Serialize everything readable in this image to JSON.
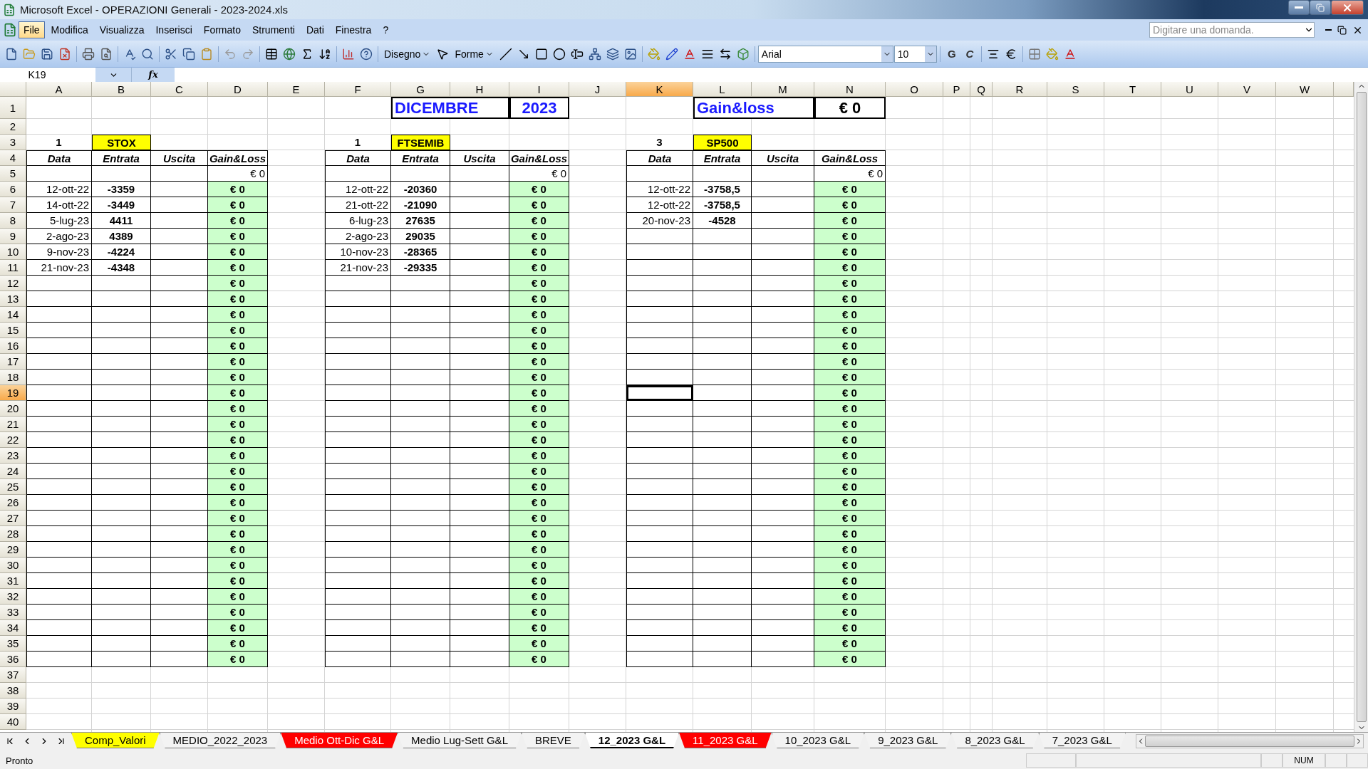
{
  "window": {
    "title": "Microsoft Excel - OPERAZIONI Generali - 2023-2024.xls"
  },
  "menu": [
    {
      "label": "File",
      "selected": true
    },
    {
      "label": "Modifica",
      "selected": false
    },
    {
      "label": "Visualizza",
      "selected": false
    },
    {
      "label": "Inserisci",
      "selected": false
    },
    {
      "label": "Formato",
      "selected": false
    },
    {
      "label": "Strumenti",
      "selected": false
    },
    {
      "label": "Dati",
      "selected": false
    },
    {
      "label": "Finestra",
      "selected": false
    },
    {
      "label": "?",
      "selected": false
    }
  ],
  "help_search": {
    "placeholder": "Digitare una domanda."
  },
  "drawing_toolbar": {
    "draw_menu": "Disegno",
    "shapes_menu": "Forme"
  },
  "formatting_toolbar": {
    "font": "Arial",
    "size": "10",
    "bold": "G",
    "italic": "C"
  },
  "formula_bar": {
    "name_box": "K19",
    "function_label": "fx"
  },
  "columns": [
    {
      "label": "A",
      "selected": false
    },
    {
      "label": "B",
      "selected": false
    },
    {
      "label": "C",
      "selected": false
    },
    {
      "label": "D",
      "selected": false
    },
    {
      "label": "E",
      "selected": false
    },
    {
      "label": "F",
      "selected": false
    },
    {
      "label": "G",
      "selected": false
    },
    {
      "label": "H",
      "selected": false
    },
    {
      "label": "I",
      "selected": false
    },
    {
      "label": "J",
      "selected": false
    },
    {
      "label": "K",
      "selected": true
    },
    {
      "label": "L",
      "selected": false
    },
    {
      "label": "M",
      "selected": false
    },
    {
      "label": "N",
      "selected": false
    },
    {
      "label": "O",
      "selected": false
    },
    {
      "label": "P",
      "selected": false
    },
    {
      "label": "Q",
      "selected": false
    },
    {
      "label": "R",
      "selected": false
    },
    {
      "label": "S",
      "selected": false
    },
    {
      "label": "T",
      "selected": false
    },
    {
      "label": "U",
      "selected": false
    },
    {
      "label": "V",
      "selected": false
    },
    {
      "label": "W",
      "selected": false
    }
  ],
  "rows": [
    {
      "label": "1",
      "selected": false
    },
    {
      "label": "2",
      "selected": false
    },
    {
      "label": "3",
      "selected": false
    },
    {
      "label": "4",
      "selected": false
    },
    {
      "label": "5",
      "selected": false
    },
    {
      "label": "6",
      "selected": false
    },
    {
      "label": "7",
      "selected": false
    },
    {
      "label": "8",
      "selected": false
    },
    {
      "label": "9",
      "selected": false
    },
    {
      "label": "10",
      "selected": false
    },
    {
      "label": "11",
      "selected": false
    },
    {
      "label": "12",
      "selected": false
    },
    {
      "label": "13",
      "selected": false
    },
    {
      "label": "14",
      "selected": false
    },
    {
      "label": "15",
      "selected": false
    },
    {
      "label": "16",
      "selected": false
    },
    {
      "label": "17",
      "selected": false
    },
    {
      "label": "18",
      "selected": false
    },
    {
      "label": "19",
      "selected": true
    },
    {
      "label": "20",
      "selected": false
    },
    {
      "label": "21",
      "selected": false
    },
    {
      "label": "22",
      "selected": false
    },
    {
      "label": "23",
      "selected": false
    },
    {
      "label": "24",
      "selected": false
    },
    {
      "label": "25",
      "selected": false
    },
    {
      "label": "26",
      "selected": false
    },
    {
      "label": "27",
      "selected": false
    },
    {
      "label": "28",
      "selected": false
    },
    {
      "label": "29",
      "selected": false
    },
    {
      "label": "30",
      "selected": false
    },
    {
      "label": "31",
      "selected": false
    },
    {
      "label": "32",
      "selected": false
    },
    {
      "label": "33",
      "selected": false
    },
    {
      "label": "34",
      "selected": false
    },
    {
      "label": "35",
      "selected": false
    },
    {
      "label": "36",
      "selected": false
    },
    {
      "label": "37",
      "selected": false
    },
    {
      "label": "38",
      "selected": false
    },
    {
      "label": "39",
      "selected": false
    },
    {
      "label": "40",
      "selected": false
    }
  ],
  "header": {
    "month": "DICEMBRE",
    "year": "2023",
    "label": "Gain&loss",
    "value": "€ 0"
  },
  "blocks": [
    {
      "number": "1",
      "name": "STOX",
      "headers": [
        "Data",
        "Entrata",
        "Uscita",
        "Gain&Loss"
      ],
      "total": "€ 0",
      "entries": [
        {
          "date": "12-ott-22",
          "entry": "-3359",
          "gain": "€ 0"
        },
        {
          "date": "14-ott-22",
          "entry": "-3449",
          "gain": "€ 0"
        },
        {
          "date": "5-lug-23",
          "entry": "4411",
          "gain": "€ 0"
        },
        {
          "date": "2-ago-23",
          "entry": "4389",
          "gain": "€ 0"
        },
        {
          "date": "9-nov-23",
          "entry": "-4224",
          "gain": "€ 0"
        },
        {
          "date": "21-nov-23",
          "entry": "-4348",
          "gain": "€ 0"
        },
        {
          "gain": "€ 0"
        },
        {
          "gain": "€ 0"
        },
        {
          "gain": "€ 0"
        },
        {
          "gain": "€ 0"
        },
        {
          "gain": "€ 0"
        },
        {
          "gain": "€ 0"
        },
        {
          "gain": "€ 0"
        },
        {
          "gain": "€ 0"
        },
        {
          "gain": "€ 0"
        },
        {
          "gain": "€ 0"
        },
        {
          "gain": "€ 0"
        },
        {
          "gain": "€ 0"
        },
        {
          "gain": "€ 0"
        },
        {
          "gain": "€ 0"
        },
        {
          "gain": "€ 0"
        },
        {
          "gain": "€ 0"
        },
        {
          "gain": "€ 0"
        },
        {
          "gain": "€ 0"
        },
        {
          "gain": "€ 0"
        },
        {
          "gain": "€ 0"
        },
        {
          "gain": "€ 0"
        },
        {
          "gain": "€ 0"
        },
        {
          "gain": "€ 0"
        },
        {
          "gain": "€ 0"
        },
        {
          "gain": "€ 0"
        }
      ]
    },
    {
      "number": "1",
      "name": "FTSEMIB",
      "headers": [
        "Data",
        "Entrata",
        "Uscita",
        "Gain&Loss"
      ],
      "total": "€ 0",
      "entries": [
        {
          "date": "12-ott-22",
          "entry": "-20360",
          "gain": "€ 0"
        },
        {
          "date": "21-ott-22",
          "entry": "-21090",
          "gain": "€ 0"
        },
        {
          "date": "6-lug-23",
          "entry": "27635",
          "gain": "€ 0"
        },
        {
          "date": "2-ago-23",
          "entry": "29035",
          "gain": "€ 0"
        },
        {
          "date": "10-nov-23",
          "entry": "-28365",
          "gain": "€ 0"
        },
        {
          "date": "21-nov-23",
          "entry": "-29335",
          "gain": "€ 0"
        },
        {
          "gain": "€ 0"
        },
        {
          "gain": "€ 0"
        },
        {
          "gain": "€ 0"
        },
        {
          "gain": "€ 0"
        },
        {
          "gain": "€ 0"
        },
        {
          "gain": "€ 0"
        },
        {
          "gain": "€ 0"
        },
        {
          "gain": "€ 0"
        },
        {
          "gain": "€ 0"
        },
        {
          "gain": "€ 0"
        },
        {
          "gain": "€ 0"
        },
        {
          "gain": "€ 0"
        },
        {
          "gain": "€ 0"
        },
        {
          "gain": "€ 0"
        },
        {
          "gain": "€ 0"
        },
        {
          "gain": "€ 0"
        },
        {
          "gain": "€ 0"
        },
        {
          "gain": "€ 0"
        },
        {
          "gain": "€ 0"
        },
        {
          "gain": "€ 0"
        },
        {
          "gain": "€ 0"
        },
        {
          "gain": "€ 0"
        },
        {
          "gain": "€ 0"
        },
        {
          "gain": "€ 0"
        },
        {
          "gain": "€ 0"
        }
      ]
    },
    {
      "number": "3",
      "name": "SP500",
      "headers": [
        "Data",
        "Entrata",
        "Uscita",
        "Gain&Loss"
      ],
      "total": "€ 0",
      "entries": [
        {
          "date": "12-ott-22",
          "entry": "-3758,5",
          "gain": "€ 0"
        },
        {
          "date": "12-ott-22",
          "entry": "-3758,5",
          "gain": "€ 0"
        },
        {
          "date": "20-nov-23",
          "entry": "-4528",
          "gain": "€ 0"
        },
        {
          "gain": "€ 0"
        },
        {
          "gain": "€ 0"
        },
        {
          "gain": "€ 0"
        },
        {
          "gain": "€ 0"
        },
        {
          "gain": "€ 0"
        },
        {
          "gain": "€ 0"
        },
        {
          "gain": "€ 0"
        },
        {
          "gain": "€ 0"
        },
        {
          "gain": "€ 0"
        },
        {
          "gain": "€ 0"
        },
        {
          "gain": "€ 0"
        },
        {
          "gain": "€ 0"
        },
        {
          "gain": "€ 0"
        },
        {
          "gain": "€ 0"
        },
        {
          "gain": "€ 0"
        },
        {
          "gain": "€ 0"
        },
        {
          "gain": "€ 0"
        },
        {
          "gain": "€ 0"
        },
        {
          "gain": "€ 0"
        },
        {
          "gain": "€ 0"
        },
        {
          "gain": "€ 0"
        },
        {
          "gain": "€ 0"
        },
        {
          "gain": "€ 0"
        },
        {
          "gain": "€ 0"
        },
        {
          "gain": "€ 0"
        },
        {
          "gain": "€ 0"
        },
        {
          "gain": "€ 0"
        },
        {
          "gain": "€ 0"
        }
      ]
    }
  ],
  "sheet_tabs": [
    {
      "label": "Comp_Valori",
      "selected": false,
      "color": "#ffff00"
    },
    {
      "label": "MEDIO_2022_2023",
      "selected": false
    },
    {
      "label": "Medio Ott-Dic G&L",
      "selected": false,
      "color": "#ff0000"
    },
    {
      "label": "Medio Lug-Sett G&L",
      "selected": false
    },
    {
      "label": "BREVE",
      "selected": false
    },
    {
      "label": "12_2023 G&L",
      "selected": true
    },
    {
      "label": "11_2023 G&L",
      "selected": false,
      "color": "#ff0000"
    },
    {
      "label": "10_2023 G&L",
      "selected": false
    },
    {
      "label": "9_2023 G&L",
      "selected": false
    },
    {
      "label": "8_2023 G&L",
      "selected": false
    },
    {
      "label": "7_2023 G&L",
      "selected": false
    }
  ],
  "status_bar": {
    "status": "Pronto",
    "num_lock": "NUM"
  }
}
